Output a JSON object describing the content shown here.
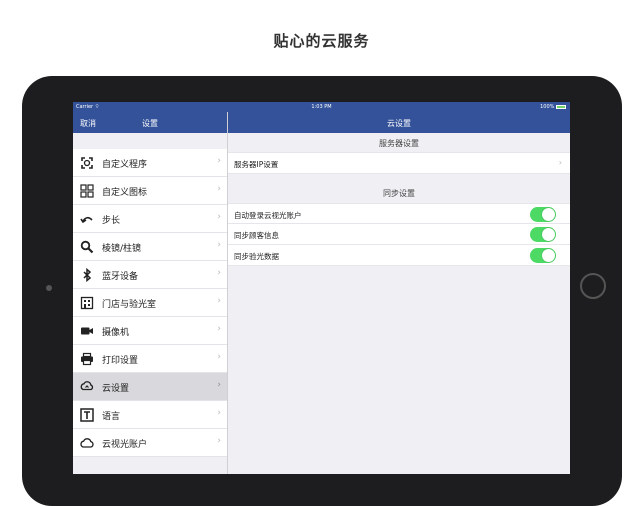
{
  "caption": "贴心的云服务",
  "status_bar": {
    "carrier": "Carrier",
    "wifi_icon": "wifi-icon",
    "time": "1:03 PM",
    "battery": "100%",
    "battery_icon": "battery-icon"
  },
  "left_nav": {
    "cancel": "取消",
    "title": "设置"
  },
  "right_nav": {
    "title": "云设置"
  },
  "sidebar": {
    "items": [
      {
        "icon": "custom-program-icon",
        "label": "自定义程序"
      },
      {
        "icon": "grid-icon",
        "label": "自定义图标"
      },
      {
        "icon": "step-arrow-icon",
        "label": "步长"
      },
      {
        "icon": "search-icon",
        "label": "棱镜/柱镜"
      },
      {
        "icon": "bluetooth-icon",
        "label": "蓝牙设备"
      },
      {
        "icon": "store-icon",
        "label": "门店与验光室"
      },
      {
        "icon": "camera-icon",
        "label": "摄像机"
      },
      {
        "icon": "printer-icon",
        "label": "打印设置"
      },
      {
        "icon": "cloud-sync-icon",
        "label": "云设置",
        "selected": true
      },
      {
        "icon": "text-icon",
        "label": "语言"
      },
      {
        "icon": "cloud-icon",
        "label": "云视光账户"
      }
    ]
  },
  "detail": {
    "server_section": {
      "header": "服务器设置",
      "rows": [
        {
          "label": "服务器IP设置"
        }
      ]
    },
    "sync_section": {
      "header": "同步设置",
      "rows": [
        {
          "label": "自动登录云视光账户",
          "on": true
        },
        {
          "label": "同步顾客信息",
          "on": true
        },
        {
          "label": "同步验光数据",
          "on": true
        }
      ]
    }
  },
  "colors": {
    "nav_bar": "#33529a",
    "toggle_on": "#4cd964",
    "background": "#efeff4"
  }
}
